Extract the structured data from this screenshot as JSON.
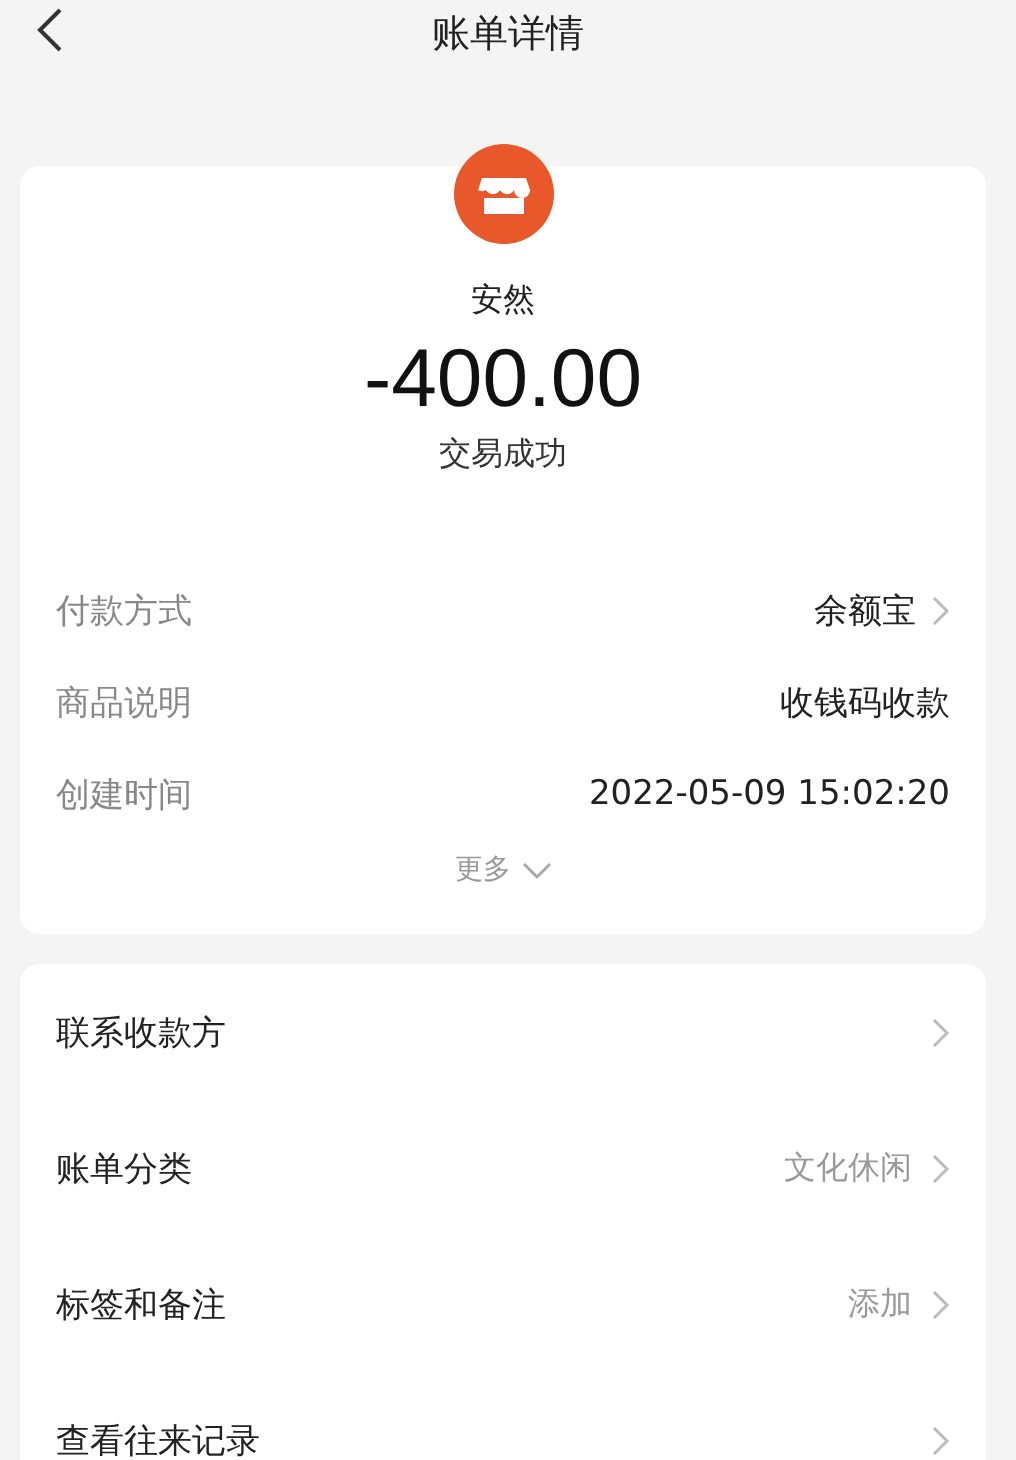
{
  "header": {
    "title": "账单详情"
  },
  "summary": {
    "payee": "安然",
    "amount": "-400.00",
    "status": "交易成功"
  },
  "details": [
    {
      "label": "付款方式",
      "value": "余额宝",
      "has_arrow": true
    },
    {
      "label": "商品说明",
      "value": "收钱码收款",
      "has_arrow": false
    },
    {
      "label": "创建时间",
      "value": "2022-05-09 15:02:20",
      "has_arrow": false
    }
  ],
  "more": "更多",
  "actions": [
    {
      "label": "联系收款方"
    },
    {
      "label": "账单分类",
      "value": "文化休闲"
    },
    {
      "label": "标签和备注",
      "value": "添加"
    },
    {
      "label": "查看往来记录"
    }
  ]
}
